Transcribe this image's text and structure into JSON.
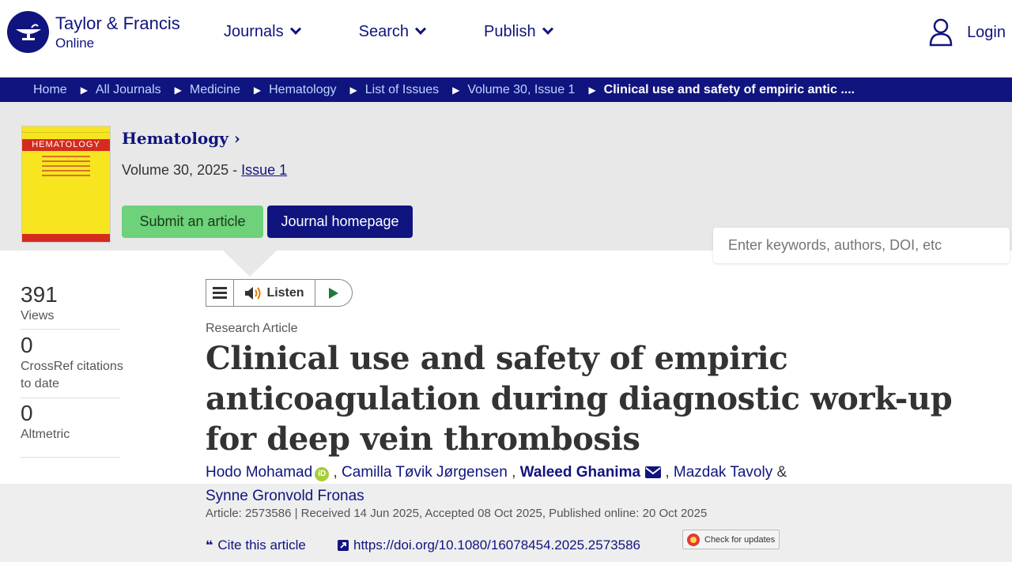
{
  "header": {
    "logo_name": "Taylor & Francis",
    "logo_sub": "Online",
    "nav": [
      {
        "label": "Journals"
      },
      {
        "label": "Search"
      },
      {
        "label": "Publish"
      }
    ],
    "login_label": "Login"
  },
  "breadcrumb": [
    "Home",
    "All Journals",
    "Medicine",
    "Hematology",
    "List of Issues",
    "Volume 30, Issue 1",
    "Clinical use and safety of empiric antic ...."
  ],
  "journal": {
    "cover_title": "HEMATOLOGY",
    "title": "Hematology ›",
    "volume_text": "Volume 30, 2025 - ",
    "issue_link": "Issue 1",
    "submit_label": "Submit an article",
    "homepage_label": "Journal homepage",
    "search_placeholder": "Enter keywords, authors, DOI, etc"
  },
  "metrics": [
    {
      "value": "391",
      "label": "Views"
    },
    {
      "value": "0",
      "label": "CrossRef citations to date"
    },
    {
      "value": "0",
      "label": "Altmetric"
    }
  ],
  "listen": {
    "label": "Listen"
  },
  "article": {
    "type": "Research Article",
    "title": "Clinical use and safety of empiric anticoagulation during diagnostic work-up for deep vein thrombosis",
    "authors": [
      {
        "name": "Hodo Mohamad"
      },
      {
        "name": "Camilla Tøvik Jørgensen"
      },
      {
        "name": "Waleed Ghanima"
      },
      {
        "name": "Mazdak Tavoly"
      },
      {
        "name": "Synne Gronvold Fronas"
      }
    ],
    "orcid_label": "iD",
    "meta": "Article: 2573586 | Received 14 Jun 2025, Accepted 08 Oct 2025, Published online: 20 Oct 2025",
    "cite_label": "Cite this article",
    "doi": "https://doi.org/10.1080/16078454.2025.2573586",
    "check_updates": "Check for updates"
  },
  "colors": {
    "brand": "#10147e",
    "submit_green": "#6dd27a",
    "banner_gray": "#e8e8e8"
  }
}
